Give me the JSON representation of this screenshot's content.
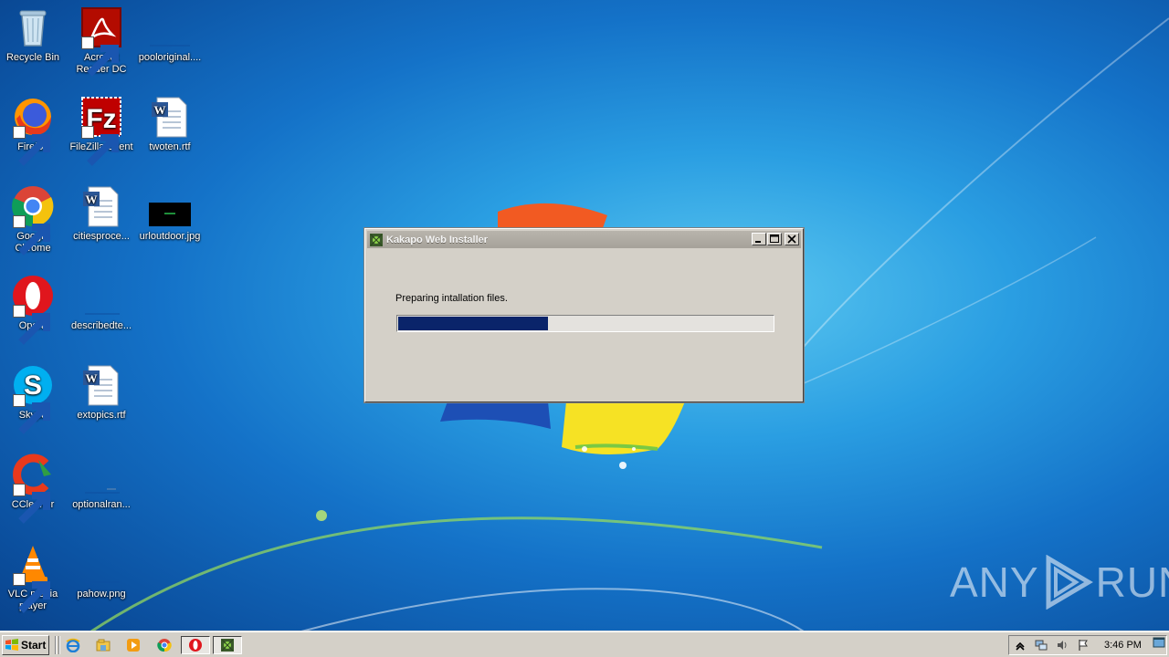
{
  "desktop_icons": [
    {
      "label": "Recycle Bin",
      "icon": "recycle-bin-icon",
      "shortcut": false
    },
    {
      "label": "Acrobat Reader DC",
      "icon": "acrobat-icon",
      "shortcut": true
    },
    {
      "label": "pooloriginal....",
      "icon": "blank-file-icon",
      "shortcut": false
    },
    {
      "label": "Firefox",
      "icon": "firefox-icon",
      "shortcut": true
    },
    {
      "label": "FileZilla Client",
      "icon": "filezilla-icon",
      "shortcut": true
    },
    {
      "label": "twoten.rtf",
      "icon": "word-doc-icon",
      "shortcut": false
    },
    {
      "label": "Google Chrome",
      "icon": "chrome-icon",
      "shortcut": true
    },
    {
      "label": "citiesproce...",
      "icon": "word-doc-icon",
      "shortcut": false
    },
    {
      "label": "urloutdoor.jpg",
      "icon": "image-thumb-icon",
      "shortcut": false
    },
    {
      "label": "Opera",
      "icon": "opera-icon",
      "shortcut": true
    },
    {
      "label": "describedte...",
      "icon": "blank-file-icon",
      "shortcut": false
    },
    {
      "label": "Skype",
      "icon": "skype-icon",
      "shortcut": true
    },
    {
      "label": "extopics.rtf",
      "icon": "word-doc-icon",
      "shortcut": false
    },
    {
      "label": "CCleaner",
      "icon": "ccleaner-icon",
      "shortcut": true
    },
    {
      "label": "optionalran...",
      "icon": "blank-file-icon",
      "shortcut": false
    },
    {
      "label": "VLC media player",
      "icon": "vlc-icon",
      "shortcut": true
    },
    {
      "label": "pahow.png",
      "icon": "blank-file-icon",
      "shortcut": false
    }
  ],
  "dialog": {
    "title": "Kakapo Web Installer",
    "status": "Preparing intallation files.",
    "progress": 0.4
  },
  "taskbar": {
    "start_label": "Start",
    "quick_launch": [
      "ie-icon",
      "explorer-icon",
      "media-player-icon",
      "chrome-icon",
      "opera-icon",
      "installer-icon"
    ],
    "clock": "3:46 PM"
  },
  "watermark": {
    "left": "ANY",
    "right": "RUN"
  },
  "colors": {
    "progress_fill": "#0a246a",
    "dialog_bg": "#d4d0c8",
    "desktop_blue": "#1472c8"
  }
}
